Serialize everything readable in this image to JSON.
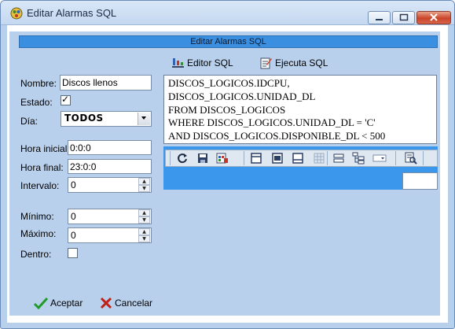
{
  "window": {
    "title": "Editar Alarmas SQL"
  },
  "header": {
    "title": "Editar Alarmas SQL"
  },
  "toolbar": {
    "editor_label": "Editor SQL",
    "execute_label": "Ejecuta SQL"
  },
  "form": {
    "nombre": {
      "label": "Nombre:",
      "value": "Discos llenos"
    },
    "estado": {
      "label": "Estado:",
      "checked": true
    },
    "dia": {
      "label": "Día:",
      "value": "TODOS"
    },
    "hora_inicial": {
      "label": "Hora inicial:",
      "value": "0:0:0"
    },
    "hora_final": {
      "label": "Hora final:",
      "value": "23:0:0"
    },
    "intervalo": {
      "label": "Intervalo:",
      "value": "0"
    },
    "minimo": {
      "label": "Mínimo:",
      "value": "0"
    },
    "maximo": {
      "label": "Máximo:",
      "value": "0"
    },
    "dentro": {
      "label": "Dentro:",
      "checked": false
    }
  },
  "sql": {
    "text": "DISCOS_LOGICOS.IDCPU,\nDISCOS_LOGICOS.UNIDAD_DL\nFROM DISCOS_LOGICOS\nWHERE DISCOS_LOGICOS.UNIDAD_DL = 'C'\nAND DISCOS_LOGICOS.DISPONIBLE_DL < 500"
  },
  "grid_toolbar": {
    "icons": [
      "refresh-icon",
      "save-icon",
      "export-icon",
      "form-view-icon",
      "edit-view-icon",
      "bottom-view-icon",
      "grid-view-icon",
      "split-horizontal-icon",
      "tree-view-icon",
      "dropdown-icon",
      "search-icon"
    ]
  },
  "actions": {
    "accept_label": "Aceptar",
    "cancel_label": "Cancelar"
  },
  "colors": {
    "panel": "#b9d0ec",
    "header_band": "#3b8fe0",
    "grid_area": "#3b97ec",
    "accept_check": "#1f9b2a",
    "cancel_x": "#c0221a"
  }
}
